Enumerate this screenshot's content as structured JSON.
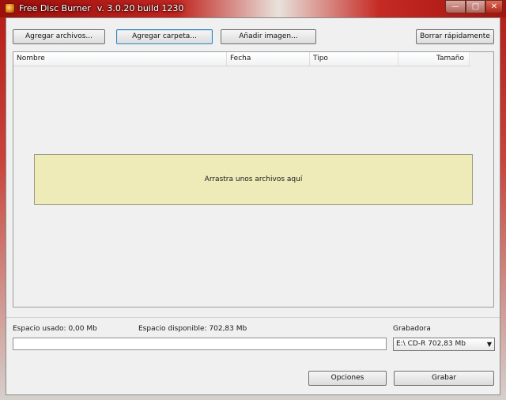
{
  "window": {
    "app_name": "Free Disc Burner",
    "version": "v. 3.0.20 build 1230",
    "controls": {
      "minimize": "—",
      "maximize": "□",
      "close": "✕"
    }
  },
  "toolbar": {
    "add_files": "Agregar archivos...",
    "add_folder": "Agregar carpeta...",
    "add_image": "Añadir imagen...",
    "quick_erase": "Borrar rápidamente"
  },
  "file_list": {
    "columns": [
      "Nombre",
      "Fecha",
      "Tipo",
      "Tamaño"
    ],
    "drop_hint": "Arrastra unos archivos aquí",
    "rows": []
  },
  "space": {
    "used_label": "Espacio usado: 0,00 Mb",
    "available_label": "Espacio disponible: 702,83 Mb",
    "used_fraction": 0
  },
  "burner": {
    "label": "Grabadora",
    "selected": "E:\\ CD-R 702,83 Mb"
  },
  "footer": {
    "options": "Opciones",
    "burn": "Grabar"
  },
  "colors": {
    "title_accent": "#b51b16",
    "drop_zone": "#eeebb8",
    "client_bg": "#f0f0f0"
  }
}
